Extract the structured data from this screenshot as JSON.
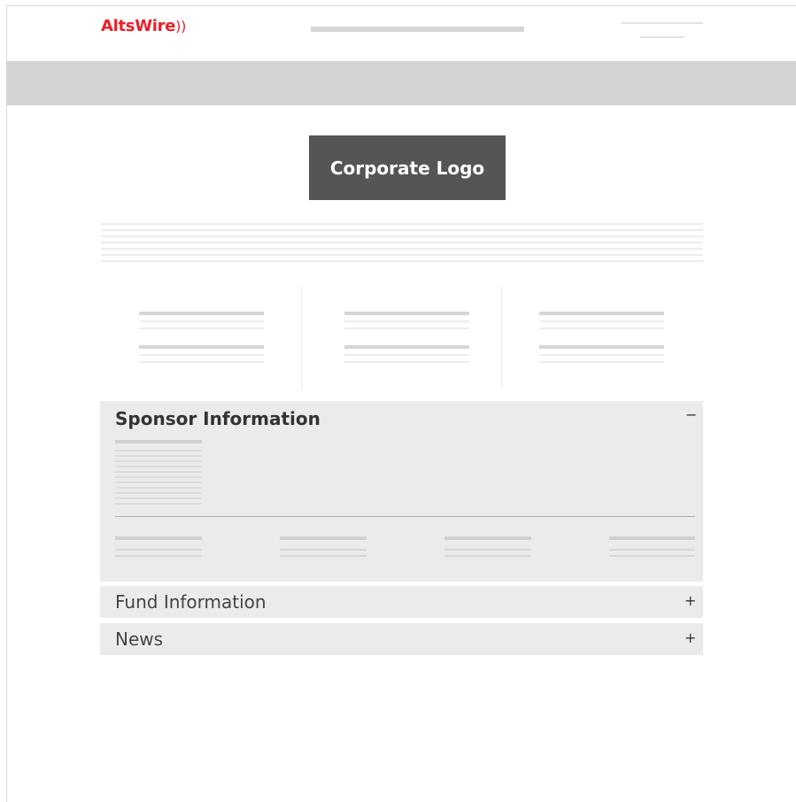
{
  "brand": {
    "name_part1": "Alts",
    "name_part2": "Wire",
    "waves": "))"
  },
  "corporate_logo": "Corporate Logo",
  "sponsor": {
    "title": "Sponsor Information",
    "toggle": "−"
  },
  "accordions": [
    {
      "label": "Fund Information",
      "toggle": "+"
    },
    {
      "label": "News",
      "toggle": "+"
    }
  ],
  "colors": {
    "brand_red": "#e8202a",
    "logo_box": "#555555",
    "panel_bg": "#ebebeb",
    "banner": "#d3d4d6"
  }
}
